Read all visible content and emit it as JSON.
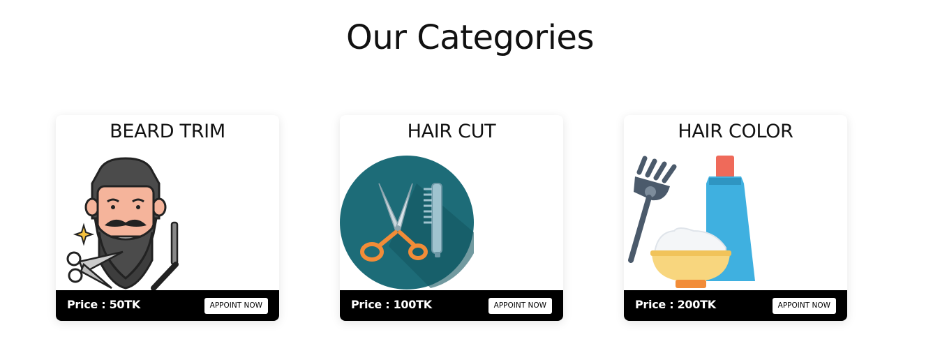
{
  "section": {
    "title": "Our Categories"
  },
  "categories": [
    {
      "title": "BEARD TRIM",
      "price": "Price : 50TK",
      "button": "APPOINT NOW",
      "icon": "barber-beard-icon"
    },
    {
      "title": "HAIR CUT",
      "price": "Price : 100TK",
      "button": "APPOINT NOW",
      "icon": "scissors-comb-icon"
    },
    {
      "title": "HAIR COLOR",
      "price": "Price : 200TK",
      "button": "APPOINT NOW",
      "icon": "hair-dye-icon"
    }
  ],
  "colors": {
    "footer_bg": "#000000",
    "haircut_circle": "#1d6c78",
    "scissor_handle": "#f28c38",
    "dye_tube": "#3fb0e0",
    "bowl": "#f8d67e"
  }
}
